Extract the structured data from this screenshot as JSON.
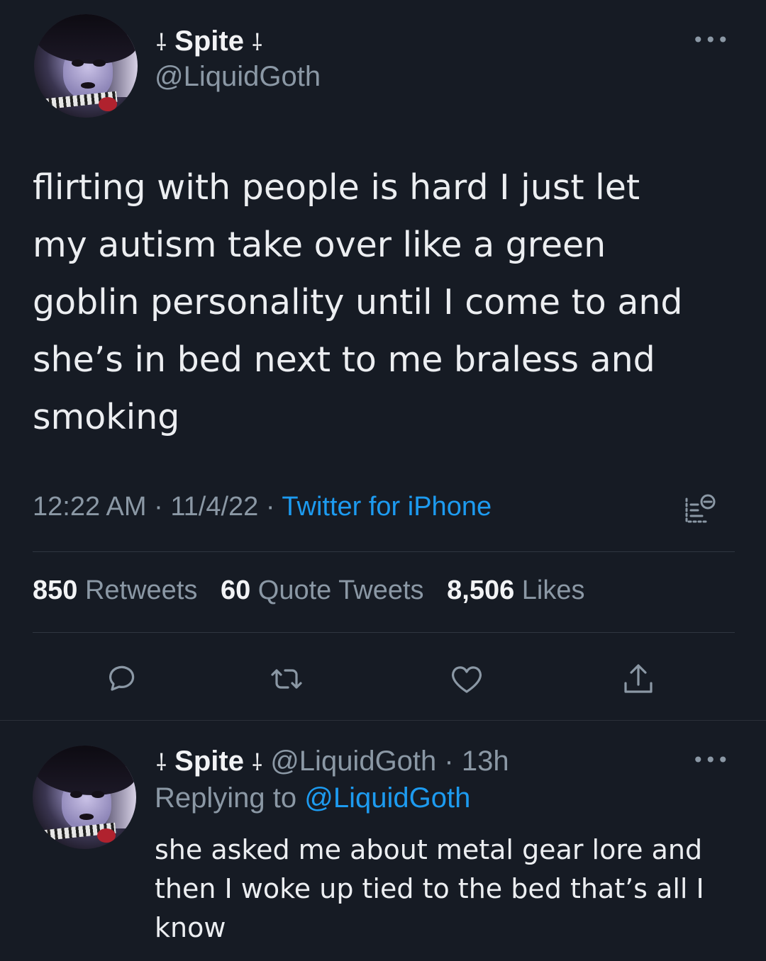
{
  "main_tweet": {
    "author": {
      "name": "Spite",
      "name_decor": "⸸",
      "handle": "@LiquidGoth"
    },
    "more_label": "•••",
    "text": "flirting with people is hard I just let\nmy autism take over like a green\ngoblin personality until I come to and\nshe’s in bed next to me braless and\nsmoking",
    "time": "12:22 AM",
    "date": "11/4/22",
    "separator": "·",
    "source": "Twitter for iPhone",
    "stats": {
      "retweets_count": "850",
      "retweets_label": "Retweets",
      "quotes_count": "60",
      "quotes_label": "Quote Tweets",
      "likes_count": "8,506",
      "likes_label": "Likes"
    },
    "actions": {
      "reply_icon": "reply-icon",
      "retweet_icon": "retweet-icon",
      "like_icon": "heart-icon",
      "share_icon": "share-icon",
      "analytics_icon": "analytics-icon"
    }
  },
  "reply_tweet": {
    "author": {
      "name": "Spite",
      "name_decor": "⸸",
      "handle": "@LiquidGoth"
    },
    "age": "13h",
    "separator": "·",
    "more_label": "•••",
    "replying_prefix": "Replying to",
    "replying_to": "@LiquidGoth",
    "text": "she asked me about metal gear lore and\nthen I woke up tied to the bed that’s all I\nknow"
  },
  "colors": {
    "background": "#161b24",
    "accent": "#1d9bf0",
    "secondary_text": "#8b98a5",
    "primary_text": "#eceef1"
  }
}
